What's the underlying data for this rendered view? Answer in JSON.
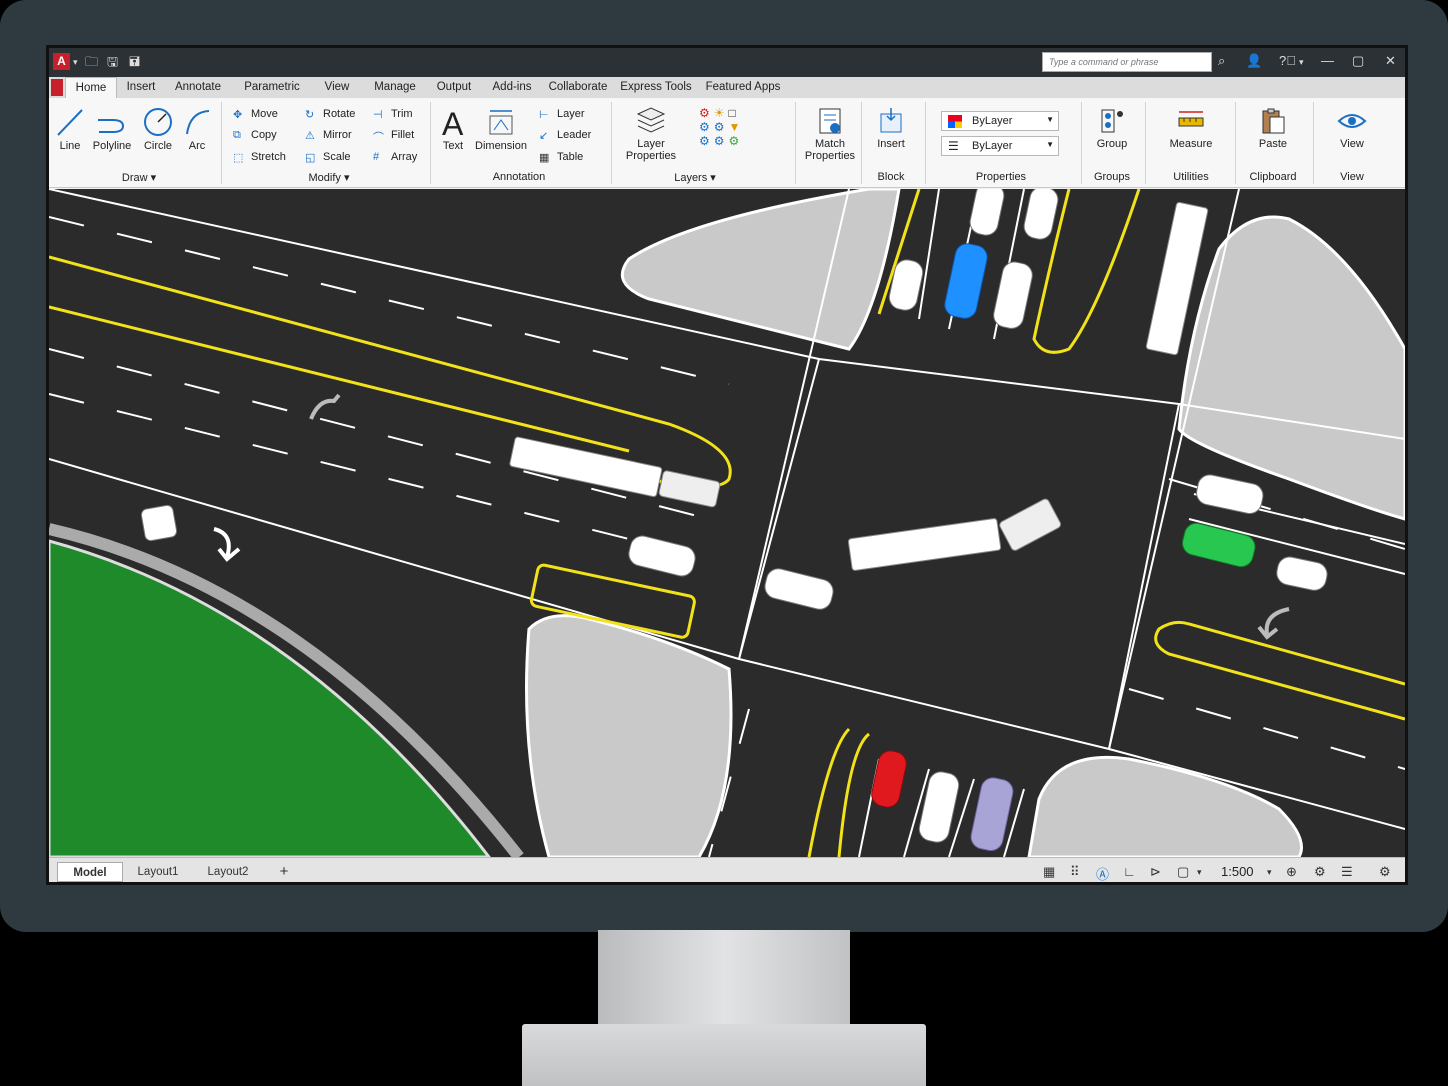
{
  "app": {
    "command_placeholder": "Type a command or phrase"
  },
  "ribbon_tabs": [
    "Home",
    "Insert",
    "Annotate",
    "Parametric",
    "View",
    "Manage",
    "Output",
    "Add-ins",
    "Collaborate",
    "Express Tools",
    "Featured Apps"
  ],
  "draw": {
    "line": "Line",
    "polyline": "Polyline",
    "circle": "Circle",
    "arc": "Arc",
    "label": "Draw ▾"
  },
  "modify": {
    "move": "Move",
    "rotate": "Rotate",
    "trim": "Trim",
    "copy": "Copy",
    "mirror": "Mirror",
    "fillet": "Fillet",
    "stretch": "Stretch",
    "scale": "Scale",
    "array": "Array",
    "label": "Modify ▾"
  },
  "annotation": {
    "text": "Text",
    "dimension": "Dimension",
    "layer": "Layer",
    "leader": "Leader",
    "table": "Table",
    "label": "Annotation"
  },
  "layers": {
    "layer_properties_1": "Layer",
    "layer_properties_2": "Properties",
    "label": "Layers ▾"
  },
  "match": {
    "line1": "Match",
    "line2": "Properties"
  },
  "block": {
    "insert": "Insert",
    "label": "Block"
  },
  "properties": {
    "color": "ByLayer",
    "linetype": "ByLayer",
    "label": "Properties"
  },
  "groups": {
    "group": "Group",
    "label": "Groups"
  },
  "utilities": {
    "measure": "Measure",
    "label": "Utilities"
  },
  "clipboard": {
    "paste": "Paste",
    "label": "Clipboard"
  },
  "viewpanel": {
    "view": "View",
    "label": "View"
  },
  "layout_tabs": {
    "model": "Model",
    "layout1": "Layout1",
    "layout2": "Layout2",
    "add": "+"
  },
  "status": {
    "zoom": "1:500"
  },
  "colors": {
    "road": "#2b2b2b",
    "lane_yellow": "#f2e21a",
    "grass": "#1e8a2a",
    "island": "#c9c9c9",
    "car_blue": "#1e90ff",
    "car_green": "#28c850",
    "car_red": "#e0191e",
    "car_lavender": "#a9a4d6"
  }
}
